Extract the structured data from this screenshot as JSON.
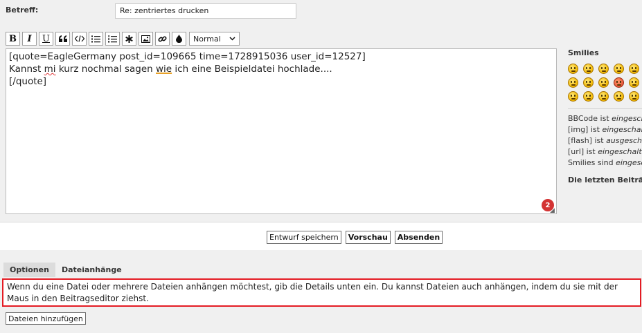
{
  "subject": {
    "label": "Betreff:",
    "value": "Re: zentriertes drucken"
  },
  "toolbar": {
    "bold": "B",
    "italic": "I",
    "underline": "U",
    "font_size": "Normal"
  },
  "editor": {
    "lines": [
      "[quote=EagleGermany post_id=109665 time=1728915036 user_id=12527]",
      "[/quote]"
    ],
    "line2": {
      "part1": "Kannst ",
      "word_misspelled": "mi",
      "part2": " kurz nochmal sagen ",
      "word_grammar": "wie",
      "part3": " ich eine Beispieldatei hochlade...."
    },
    "spell_badge": "2"
  },
  "sidebar": {
    "smilies_title": "Smilies",
    "bbcode": {
      "text": "BBCode ist ",
      "state": "eingeschaltet"
    },
    "img": {
      "text": "[img] ist ",
      "state": "eingeschaltet"
    },
    "flash": {
      "text": "[flash] ist ",
      "state": "ausgeschaltet"
    },
    "url": {
      "text": "[url] ist ",
      "state": "eingeschaltet"
    },
    "smilies": {
      "text": "Smilies sind ",
      "state": "eingeschaltet"
    },
    "last_posts": "Die letzten Beiträge"
  },
  "actions": {
    "save_draft": "Entwurf speichern",
    "preview": "Vorschau",
    "submit": "Absenden"
  },
  "tabs": [
    {
      "label": "Optionen",
      "active": true
    },
    {
      "label": "Dateianhänge",
      "active": false
    }
  ],
  "attachments": {
    "info": "Wenn du eine Datei oder mehrere Dateien anhängen möchtest, gib die Details unten ein. Du kannst Dateien auch anhängen, indem du sie mit der Maus in den Beitragseditor ziehst.",
    "add_button": "Dateien hinzufügen"
  },
  "colors": {
    "highlight_border": "#e41b23",
    "badge": "#d33333"
  }
}
